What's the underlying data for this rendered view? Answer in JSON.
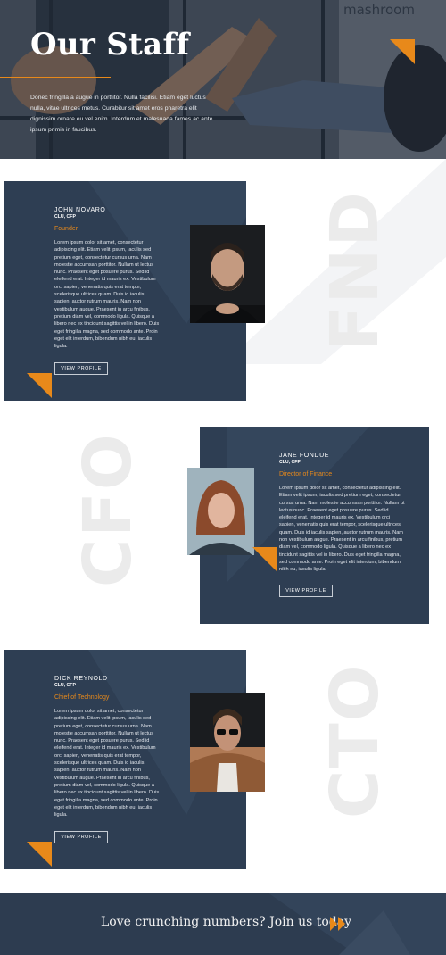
{
  "hero": {
    "title": "Our Staff",
    "text": "Donec fringilla a augue in porttitor. Nulla facilisi. Etiam eget luctus nulla, vitae ultrices metus. Curabitur sit amet eros pharetra elit dignissim ornare eu vel enim. Interdum et malesuada fames ac ante ipsum primis in faucibus.",
    "sign_text": "mashroom"
  },
  "staff": [
    {
      "name": "JOHN NOVARO",
      "credentials": "CLU, CFP",
      "role": "Founder",
      "bio": "Lorem ipsum dolor sit amet, consectetur adipiscing elit. Etiam velit ipsum, iaculis sed pretium eget, consectetur cursus urna. Nam molestie accumsan porttitor. Nullam ut lectus nunc. Praesent eget posuere purus. Sed id eleifend erat. Integer id mauris ex. Vestibulum orci sapien, venenatis quis erat tempor, scelerisque ultrices quam. Duis id iaculis sapien, auctor rutrum mauris. Nam non vestibulum augue. Praesent in arcu finibus, pretium diam vel, commodo ligula. Quisque a libero nec ex tincidunt sagittis vel in libero. Duis eget fringilla magna, sed commodo ante. Proin eget elit interdum, bibendum nibh eu, iaculis ligula.",
      "button": "VIEW PROFILE",
      "ghost": "FND"
    },
    {
      "name": "JANE FONDUE",
      "credentials": "CLU, CFP",
      "role": "Director of Finance",
      "bio": "Lorem ipsum dolor sit amet, consectetur adipiscing elit. Etiam velit ipsum, iaculis sed pretium eget, consectetur cursus urna. Nam molestie accumsan porttitor. Nullam ut lectus nunc. Praesent eget posuere purus. Sed id eleifend erat. Integer id mauris ex. Vestibulum orci sapien, venenatis quis erat tempor, scelerisque ultrices quam. Duis id iaculis sapien, auctor rutrum mauris. Nam non vestibulum augue. Praesent in arcu finibus, pretium diam vel, commodo ligula. Quisque a libero nec ex tincidunt sagittis vel in libero. Duis eget fringilla magna, sed commodo ante. Proin eget elit interdum, bibendum nibh eu, iaculis ligula.",
      "button": "VIEW PROFILE",
      "ghost": "CFO"
    },
    {
      "name": "DICK REYNOLD",
      "credentials": "CLU, CFP",
      "role": "Chief of Technology",
      "bio": "Lorem ipsum dolor sit amet, consectetur adipiscing elit. Etiam velit ipsum, iaculis sed pretium eget, consectetur cursus urna. Nam molestie accumsan porttitor. Nullam ut lectus nunc. Praesent eget posuere purus. Sed id eleifend erat. Integer id mauris ex. Vestibulum orci sapien, venenatis quis erat tempor, scelerisque ultrices quam. Duis id iaculis sapien, auctor rutrum mauris. Nam non vestibulum augue. Praesent in arcu finibus, pretium diam vel, commodo ligula. Quisque a libero nec ex tincidunt sagittis vel in libero. Duis eget fringilla magna, sed commodo ante. Proin eget elit interdum, bibendum nibh eu, iaculis ligula.",
      "button": "VIEW PROFILE",
      "ghost": "CTO"
    }
  ],
  "cta": {
    "text": "Love crunching numbers? Join us today",
    "icon": "double-chevron-right-icon"
  },
  "colors": {
    "accent": "#e8891a",
    "card": "#2e3e53",
    "footer": "#2d3c50"
  }
}
